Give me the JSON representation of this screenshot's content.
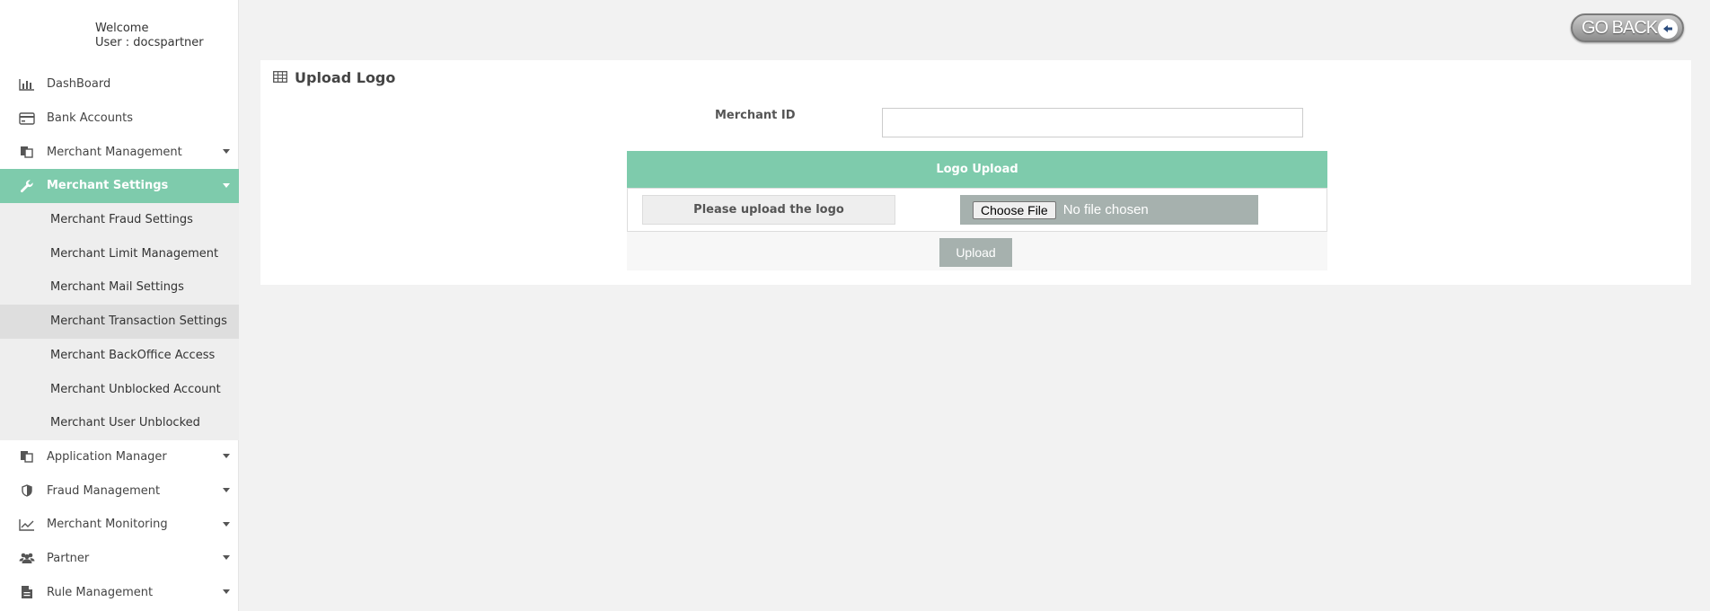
{
  "user": {
    "welcome": "Welcome",
    "user_line": "User : docspartner"
  },
  "nav": {
    "dashboard": "DashBoard",
    "bank_accounts": "Bank Accounts",
    "merchant_management": "Merchant Management",
    "merchant_settings": "Merchant Settings",
    "sub": [
      "Merchant Fraud Settings",
      "Merchant Limit Management",
      "Merchant Mail Settings",
      "Merchant Transaction Settings",
      "Merchant BackOffice Access",
      "Merchant Unblocked Account",
      "Merchant User Unblocked"
    ],
    "application_manager": "Application Manager",
    "fraud_management": "Fraud Management",
    "merchant_monitoring": "Merchant Monitoring",
    "partner": "Partner",
    "rule_management": "Rule Management"
  },
  "header": {
    "go_back": "GO BACK"
  },
  "panel": {
    "title": "Upload Logo",
    "merchant_id_label": "Merchant ID",
    "merchant_id_value": "",
    "logo_upload_header": "Logo Upload",
    "upload_prompt": "Please upload the logo",
    "choose_file": "Choose File",
    "no_file": "No file chosen",
    "upload_button": "Upload"
  },
  "colors": {
    "accent": "#7ecbac",
    "button_gray": "#a6b1ae",
    "background": "#f2f2f2"
  }
}
